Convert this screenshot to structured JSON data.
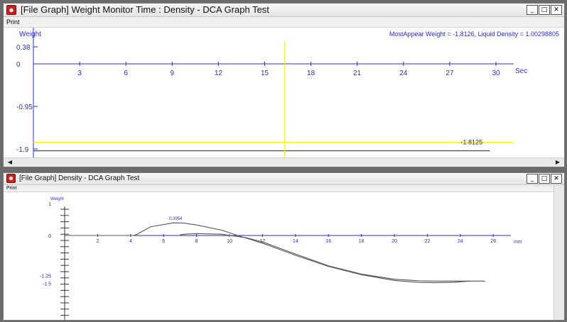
{
  "window1": {
    "title": "[File Graph] Weight Monitor Time : Density - DCA Graph Test",
    "menu": "Print",
    "controls": [
      "_",
      "□",
      "✕"
    ],
    "y_axis_label": "Weight",
    "x_axis_unit": "Sec",
    "info_text": "MostAppear Weight = -1.8126, Liquid Density = 1.00298805",
    "cursor_value": "-1.8125",
    "y_ticks": [
      {
        "label": "0.38",
        "v": 0.38
      },
      {
        "label": "0",
        "v": 0
      },
      {
        "label": "-0.95",
        "v": -0.95
      },
      {
        "label": "-1.9",
        "v": -1.9
      }
    ],
    "x_ticks": [
      "3",
      "6",
      "9",
      "12",
      "15",
      "18",
      "21",
      "24",
      "27",
      "30"
    ]
  },
  "window2": {
    "title": "[File Graph] Density - DCA Graph Test",
    "menu": "Print",
    "controls": [
      "_",
      "□",
      "✕"
    ],
    "y_axis_label": "Weight",
    "x_axis_unit": "mm",
    "peak_label": "0.3954",
    "y_ticks": [
      {
        "label": "1",
        "v": 1
      },
      {
        "label": "0",
        "v": 0
      },
      {
        "label": "-1.25",
        "v": -1.25
      },
      {
        "label": "-1.5",
        "v": -1.5
      }
    ],
    "x_ticks": [
      "2",
      "4",
      "6",
      "8",
      "10",
      "12",
      "14",
      "16",
      "18",
      "20",
      "22",
      "24",
      "26"
    ]
  },
  "colors": {
    "axis": "#2b2bd6",
    "cursor": "#f2f200",
    "trace": "#555555"
  },
  "chart_data": [
    {
      "type": "line",
      "title": "",
      "xlabel": "Sec",
      "ylabel": "Weight",
      "xlim": [
        0,
        31
      ],
      "ylim": [
        -1.9,
        0.38
      ],
      "x_cursor": 16.3,
      "y_cursor": -1.8125,
      "series": [
        {
          "x": [
            0,
            29.6
          ],
          "y": [
            -1.8125,
            -1.8125
          ]
        }
      ]
    },
    {
      "type": "line",
      "title": "",
      "xlabel": "mm",
      "ylabel": "Weight",
      "xlim": [
        0,
        27
      ],
      "ylim": [
        -1.5,
        1
      ],
      "series": [
        {
          "x": [
            0,
            4.2,
            4.4,
            5.2,
            6.6,
            7.2,
            8.0,
            9.5,
            10.8,
            12.0,
            14.0,
            16.0,
            18.0,
            20.0,
            21.5,
            22.5,
            23.5,
            24.6,
            25.5
          ],
          "y": [
            0,
            0,
            0.04,
            0.27,
            0.3954,
            0.39,
            0.33,
            0.17,
            -0.05,
            -0.24,
            -0.62,
            -0.97,
            -1.23,
            -1.41,
            -1.47,
            -1.48,
            -1.47,
            -1.43,
            -1.43
          ]
        },
        {
          "x": [
            7.0,
            7.3,
            8.0,
            9.5,
            11.0,
            12.0,
            14.0,
            16.0,
            18.0,
            20.0,
            21.5,
            22.5,
            23.8,
            24.6
          ],
          "y": [
            0.02,
            0.04,
            0.06,
            0.04,
            -0.07,
            -0.2,
            -0.58,
            -0.95,
            -1.21,
            -1.37,
            -1.42,
            -1.43,
            -1.43,
            -1.43
          ]
        }
      ]
    }
  ]
}
